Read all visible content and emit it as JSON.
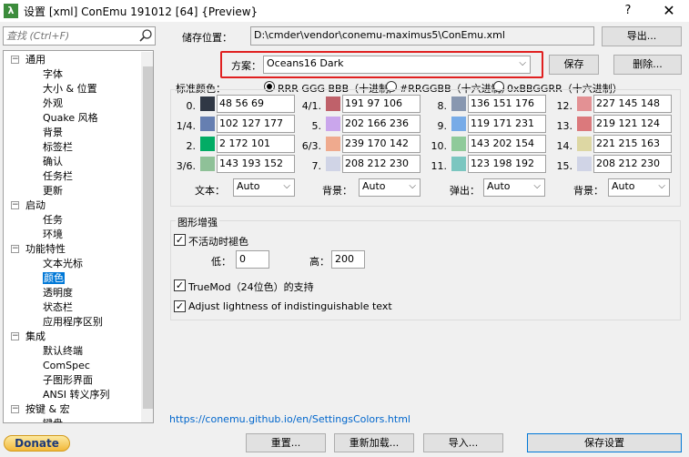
{
  "window": {
    "icon_glyph": "λ",
    "title": "设置 [xml] ConEmu 191012 [64] {Preview}",
    "help_glyph": "?",
    "close_glyph": "✕"
  },
  "search": {
    "placeholder": "査找 (Ctrl+F)"
  },
  "tree": {
    "items": [
      {
        "label": "通用",
        "indent": 0,
        "expanded": true
      },
      {
        "label": "字体",
        "indent": 1
      },
      {
        "label": "大小 & 位置",
        "indent": 1
      },
      {
        "label": "外观",
        "indent": 1
      },
      {
        "label": "Quake 风格",
        "indent": 1
      },
      {
        "label": "背景",
        "indent": 1
      },
      {
        "label": "标签栏",
        "indent": 1
      },
      {
        "label": "确认",
        "indent": 1
      },
      {
        "label": "任务栏",
        "indent": 1
      },
      {
        "label": "更新",
        "indent": 1
      },
      {
        "label": "启动",
        "indent": 0,
        "expanded": true
      },
      {
        "label": "任务",
        "indent": 1
      },
      {
        "label": "环境",
        "indent": 1
      },
      {
        "label": "功能特性",
        "indent": 0,
        "expanded": true
      },
      {
        "label": "文本光标",
        "indent": 1
      },
      {
        "label": "颜色",
        "indent": 1,
        "selected": true
      },
      {
        "label": "透明度",
        "indent": 1
      },
      {
        "label": "状态栏",
        "indent": 1
      },
      {
        "label": "应用程序区别",
        "indent": 1
      },
      {
        "label": "集成",
        "indent": 0,
        "expanded": true
      },
      {
        "label": "默认终端",
        "indent": 1
      },
      {
        "label": "ComSpec",
        "indent": 1
      },
      {
        "label": "子图形界面",
        "indent": 1
      },
      {
        "label": "ANSI 转义序列",
        "indent": 1
      },
      {
        "label": "按键 & 宏",
        "indent": 0,
        "expanded": true
      },
      {
        "label": "键盘",
        "indent": 1
      }
    ]
  },
  "storage": {
    "label": "储存位置：",
    "path": "D:\\cmder\\vendor\\conemu-maximus5\\ConEmu.xml",
    "export_label": "导出..."
  },
  "scheme": {
    "label": "方案：",
    "value": "Oceans16 Dark",
    "save_label": "保存",
    "delete_label": "删除..."
  },
  "std_colors": {
    "label": "标准颜色：",
    "format_options": [
      "RRR GGG BBB（十进制）",
      "#RRGGBB（十六进制）",
      "0xBBGGRR（十六进制）"
    ],
    "selected_format": 0,
    "colors": [
      {
        "index": "0.",
        "value": "48 56 69",
        "hex": "#303845"
      },
      {
        "index": "1/4.",
        "value": "102 127 177",
        "hex": "#667fb1"
      },
      {
        "index": "2.",
        "value": "2 172 101",
        "hex": "#02ac65"
      },
      {
        "index": "3/6.",
        "value": "143 193 152",
        "hex": "#8fc198"
      },
      {
        "index": "4/1.",
        "value": "191 97 106",
        "hex": "#bf616a"
      },
      {
        "index": "5.",
        "value": "202 166 236",
        "hex": "#caa6ec"
      },
      {
        "index": "6/3.",
        "value": "239 170 142",
        "hex": "#efaa8e"
      },
      {
        "index": "7.",
        "value": "208 212 230",
        "hex": "#d0d4e6"
      },
      {
        "index": "8.",
        "value": "136 151 176",
        "hex": "#8897b0"
      },
      {
        "index": "9.",
        "value": "119 171 231",
        "hex": "#77abe7"
      },
      {
        "index": "10.",
        "value": "143 202 154",
        "hex": "#8fca9a"
      },
      {
        "index": "11.",
        "value": "123 198 192",
        "hex": "#7bc6c0"
      },
      {
        "index": "12.",
        "value": "227 145 148",
        "hex": "#e39194"
      },
      {
        "index": "13.",
        "value": "219 121 124",
        "hex": "#db797c"
      },
      {
        "index": "14.",
        "value": "221 215 163",
        "hex": "#ddd7a3"
      },
      {
        "index": "15.",
        "value": "208 212 230",
        "hex": "#d0d4e6"
      }
    ]
  },
  "selectors": [
    {
      "label": "文本：",
      "value": "Auto"
    },
    {
      "label": "背景：",
      "value": "Auto"
    },
    {
      "label": "弹出：",
      "value": "Auto"
    },
    {
      "label": "背景：",
      "value": "Auto"
    }
  ],
  "graphics": {
    "title": "图形增强",
    "fade_label": "不活动时褪色",
    "fade_checked": true,
    "low_label": "低：",
    "low_value": "0",
    "high_label": "高：",
    "high_value": "200",
    "truemod_label": "TrueMod（24位色）的支持",
    "truemod_checked": true,
    "adjust_label": "Adjust lightness of indistinguishable text",
    "adjust_checked": true,
    "check_glyph": "✓"
  },
  "help_link": "https://conemu.github.io/en/SettingsColors.html",
  "footer": {
    "donate_label": "Donate",
    "reset_label": "重置...",
    "reload_label": "重新加载...",
    "import_label": "导入...",
    "save_settings_label": "保存设置"
  }
}
